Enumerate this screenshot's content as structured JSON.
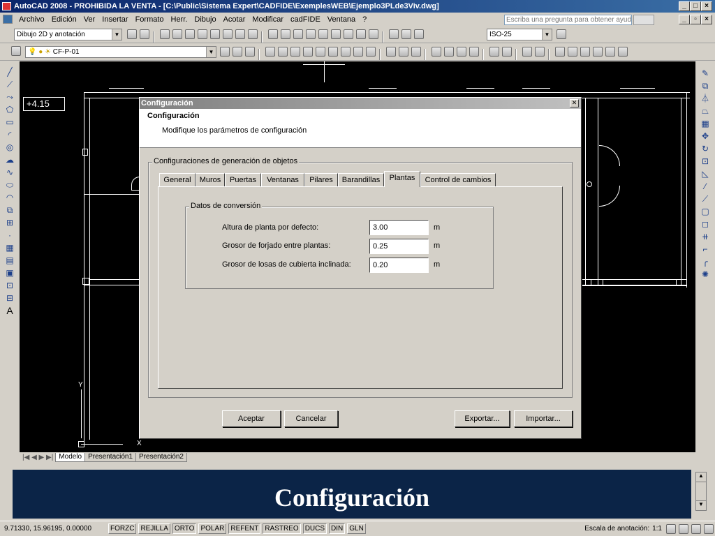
{
  "window": {
    "title": "AutoCAD 2008 - PROHIBIDA LA VENTA - [C:\\Public\\Sistema Expert\\CADFIDE\\ExemplesWEB\\Ejemplo3PLde3Viv.dwg]"
  },
  "menubar": {
    "items": [
      "Archivo",
      "Edición",
      "Ver",
      "Insertar",
      "Formato",
      "Herr.",
      "Dibujo",
      "Acotar",
      "Modificar",
      "cadFIDE",
      "Ventana",
      "?"
    ],
    "help_placeholder": "Escriba una pregunta para obtener ayuda"
  },
  "toolbar": {
    "workspace": "Dibujo 2D y anotación",
    "dimstyle": "ISO-25",
    "layer": "CF-P-01"
  },
  "drawing": {
    "elevation_label": "+4.15"
  },
  "layout_tabs": [
    "Modelo",
    "Presentación1",
    "Presentación2"
  ],
  "dialog": {
    "title": "Configuración",
    "header_title": "Configuración",
    "header_subtitle": "Modifique los parámetros de configuración",
    "group_label": "Configuraciones de generación de objetos",
    "tabs": [
      "General",
      "Muros",
      "Puertas",
      "Ventanas",
      "Pilares",
      "Barandillas",
      "Plantas",
      "Control de cambios"
    ],
    "active_tab": "Plantas",
    "conversion_group": "Datos de conversión",
    "fields": [
      {
        "label": "Altura de planta por defecto:",
        "value": "3.00",
        "unit": "m"
      },
      {
        "label": "Grosor de forjado entre plantas:",
        "value": "0.25",
        "unit": "m"
      },
      {
        "label": "Grosor de losas de cubierta inclinada:",
        "value": "0.20",
        "unit": "m"
      }
    ],
    "buttons": {
      "ok": "Aceptar",
      "cancel": "Cancelar",
      "export": "Exportar...",
      "import": "Importar..."
    }
  },
  "banner": {
    "text": "Configuración"
  },
  "statusbar": {
    "coords": "9.71330, 15.96195, 0.00000",
    "toggles": [
      "FORZC",
      "REJILLA",
      "ORTO",
      "POLAR",
      "REFENT",
      "RASTREO",
      "DUCS",
      "DIN",
      "GLN"
    ],
    "annotation_scale_label": "Escala de anotación:",
    "annotation_scale": "1:1"
  }
}
